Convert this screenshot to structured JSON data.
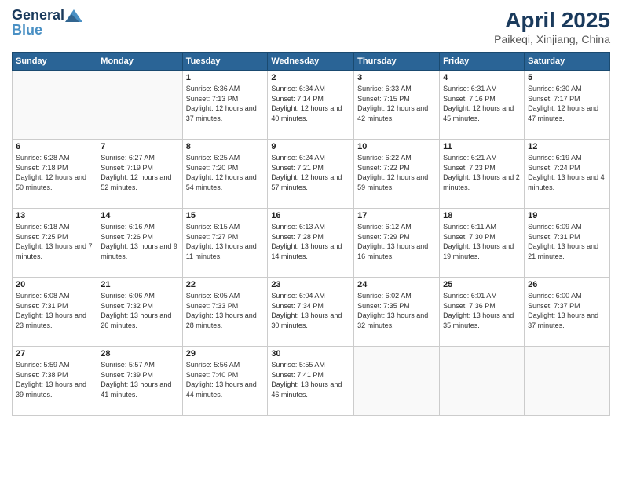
{
  "header": {
    "logo_line1": "General",
    "logo_line2": "Blue",
    "month_year": "April 2025",
    "location": "Paikeqi, Xinjiang, China"
  },
  "days_of_week": [
    "Sunday",
    "Monday",
    "Tuesday",
    "Wednesday",
    "Thursday",
    "Friday",
    "Saturday"
  ],
  "weeks": [
    [
      {
        "day": "",
        "info": ""
      },
      {
        "day": "",
        "info": ""
      },
      {
        "day": "1",
        "info": "Sunrise: 6:36 AM\nSunset: 7:13 PM\nDaylight: 12 hours\nand 37 minutes."
      },
      {
        "day": "2",
        "info": "Sunrise: 6:34 AM\nSunset: 7:14 PM\nDaylight: 12 hours\nand 40 minutes."
      },
      {
        "day": "3",
        "info": "Sunrise: 6:33 AM\nSunset: 7:15 PM\nDaylight: 12 hours\nand 42 minutes."
      },
      {
        "day": "4",
        "info": "Sunrise: 6:31 AM\nSunset: 7:16 PM\nDaylight: 12 hours\nand 45 minutes."
      },
      {
        "day": "5",
        "info": "Sunrise: 6:30 AM\nSunset: 7:17 PM\nDaylight: 12 hours\nand 47 minutes."
      }
    ],
    [
      {
        "day": "6",
        "info": "Sunrise: 6:28 AM\nSunset: 7:18 PM\nDaylight: 12 hours\nand 50 minutes."
      },
      {
        "day": "7",
        "info": "Sunrise: 6:27 AM\nSunset: 7:19 PM\nDaylight: 12 hours\nand 52 minutes."
      },
      {
        "day": "8",
        "info": "Sunrise: 6:25 AM\nSunset: 7:20 PM\nDaylight: 12 hours\nand 54 minutes."
      },
      {
        "day": "9",
        "info": "Sunrise: 6:24 AM\nSunset: 7:21 PM\nDaylight: 12 hours\nand 57 minutes."
      },
      {
        "day": "10",
        "info": "Sunrise: 6:22 AM\nSunset: 7:22 PM\nDaylight: 12 hours\nand 59 minutes."
      },
      {
        "day": "11",
        "info": "Sunrise: 6:21 AM\nSunset: 7:23 PM\nDaylight: 13 hours\nand 2 minutes."
      },
      {
        "day": "12",
        "info": "Sunrise: 6:19 AM\nSunset: 7:24 PM\nDaylight: 13 hours\nand 4 minutes."
      }
    ],
    [
      {
        "day": "13",
        "info": "Sunrise: 6:18 AM\nSunset: 7:25 PM\nDaylight: 13 hours\nand 7 minutes."
      },
      {
        "day": "14",
        "info": "Sunrise: 6:16 AM\nSunset: 7:26 PM\nDaylight: 13 hours\nand 9 minutes."
      },
      {
        "day": "15",
        "info": "Sunrise: 6:15 AM\nSunset: 7:27 PM\nDaylight: 13 hours\nand 11 minutes."
      },
      {
        "day": "16",
        "info": "Sunrise: 6:13 AM\nSunset: 7:28 PM\nDaylight: 13 hours\nand 14 minutes."
      },
      {
        "day": "17",
        "info": "Sunrise: 6:12 AM\nSunset: 7:29 PM\nDaylight: 13 hours\nand 16 minutes."
      },
      {
        "day": "18",
        "info": "Sunrise: 6:11 AM\nSunset: 7:30 PM\nDaylight: 13 hours\nand 19 minutes."
      },
      {
        "day": "19",
        "info": "Sunrise: 6:09 AM\nSunset: 7:31 PM\nDaylight: 13 hours\nand 21 minutes."
      }
    ],
    [
      {
        "day": "20",
        "info": "Sunrise: 6:08 AM\nSunset: 7:31 PM\nDaylight: 13 hours\nand 23 minutes."
      },
      {
        "day": "21",
        "info": "Sunrise: 6:06 AM\nSunset: 7:32 PM\nDaylight: 13 hours\nand 26 minutes."
      },
      {
        "day": "22",
        "info": "Sunrise: 6:05 AM\nSunset: 7:33 PM\nDaylight: 13 hours\nand 28 minutes."
      },
      {
        "day": "23",
        "info": "Sunrise: 6:04 AM\nSunset: 7:34 PM\nDaylight: 13 hours\nand 30 minutes."
      },
      {
        "day": "24",
        "info": "Sunrise: 6:02 AM\nSunset: 7:35 PM\nDaylight: 13 hours\nand 32 minutes."
      },
      {
        "day": "25",
        "info": "Sunrise: 6:01 AM\nSunset: 7:36 PM\nDaylight: 13 hours\nand 35 minutes."
      },
      {
        "day": "26",
        "info": "Sunrise: 6:00 AM\nSunset: 7:37 PM\nDaylight: 13 hours\nand 37 minutes."
      }
    ],
    [
      {
        "day": "27",
        "info": "Sunrise: 5:59 AM\nSunset: 7:38 PM\nDaylight: 13 hours\nand 39 minutes."
      },
      {
        "day": "28",
        "info": "Sunrise: 5:57 AM\nSunset: 7:39 PM\nDaylight: 13 hours\nand 41 minutes."
      },
      {
        "day": "29",
        "info": "Sunrise: 5:56 AM\nSunset: 7:40 PM\nDaylight: 13 hours\nand 44 minutes."
      },
      {
        "day": "30",
        "info": "Sunrise: 5:55 AM\nSunset: 7:41 PM\nDaylight: 13 hours\nand 46 minutes."
      },
      {
        "day": "",
        "info": ""
      },
      {
        "day": "",
        "info": ""
      },
      {
        "day": "",
        "info": ""
      }
    ]
  ]
}
